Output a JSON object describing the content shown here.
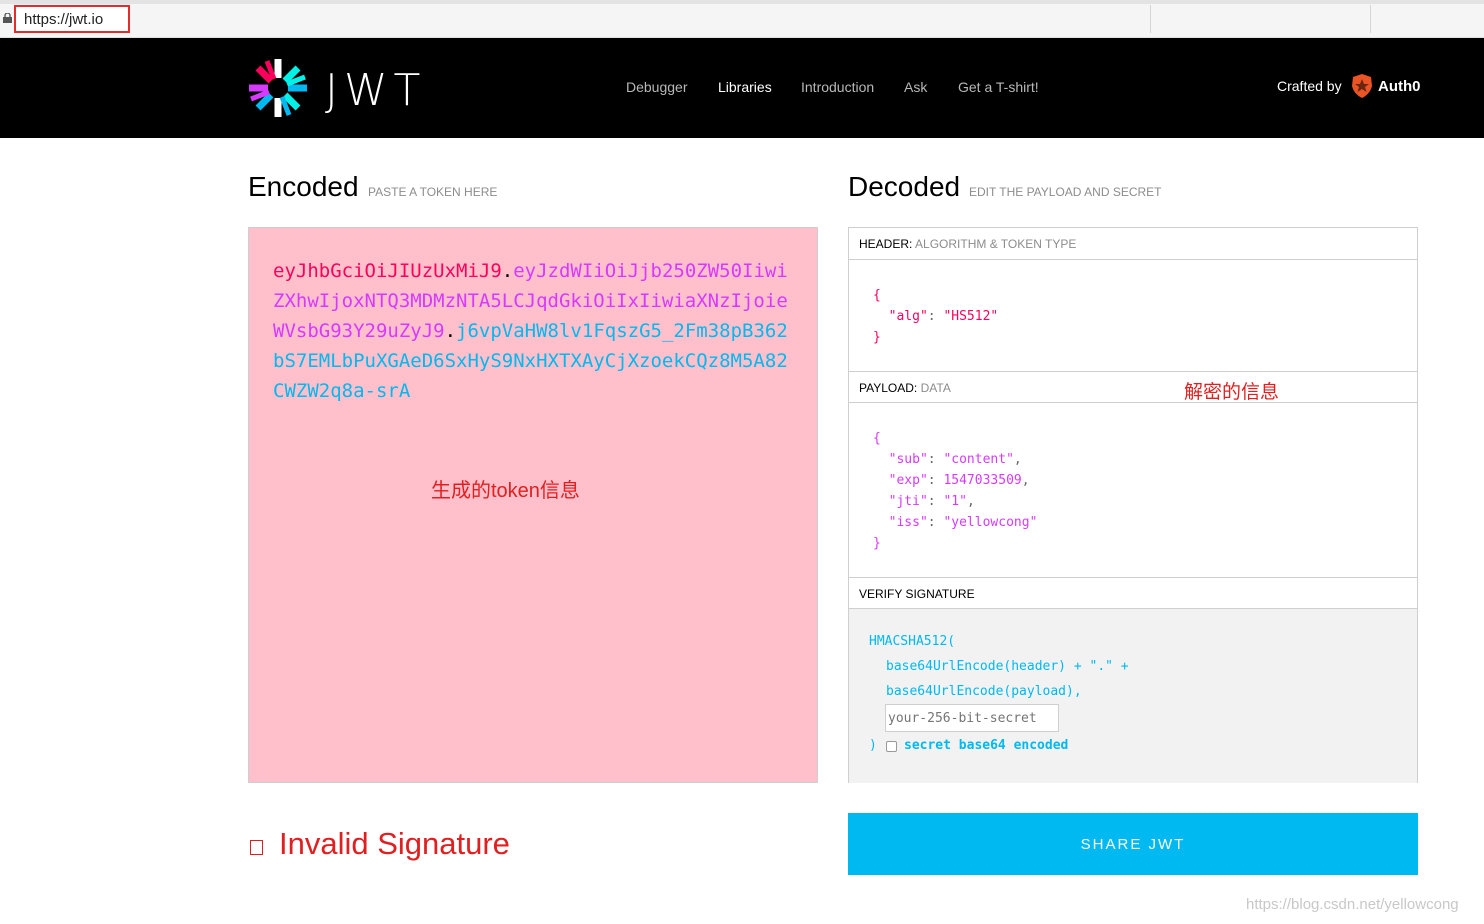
{
  "browser": {
    "url": "https://jwt.io"
  },
  "nav": {
    "logo_text": "JWT",
    "links": [
      "Debugger",
      "Libraries",
      "Introduction",
      "Ask",
      "Get a T-shirt!"
    ],
    "active": "Libraries",
    "crafted_by": "Crafted by",
    "brand": "Auth0"
  },
  "encoded": {
    "title": "Encoded",
    "subtitle": "PASTE A TOKEN HERE",
    "token_header": "eyJhbGciOiJIUzUxMiJ9",
    "token_payload": "eyJzdWIiOiJjb250ZW50IiwiZXhwIjoxNTQ3MDMzNTA5LCJqdGkiOiIxIiwiaXNzIjoieWVsbG93Y29uZyJ9",
    "token_signature": "j6vpVaHW8lv1FqszG5_2Fm38pB362bS7EMLbPuXGAeD6SxHyS9NxHXTXAyCjXzoekCQz8M5A82CWZW2q8a-srA",
    "dot": ".",
    "annotation": "生成的token信息"
  },
  "decoded": {
    "title": "Decoded",
    "subtitle": "EDIT THE PAYLOAD AND SECRET",
    "header_section": {
      "label": "HEADER:",
      "sublabel": "ALGORITHM & TOKEN TYPE"
    },
    "header_json": {
      "alg": "HS512"
    },
    "payload_section": {
      "label": "PAYLOAD:",
      "sublabel": "DATA"
    },
    "payload_annotation": "解密的信息",
    "payload_json": {
      "sub": "content",
      "exp": "1547033509",
      "jti": "1",
      "iss": "yellowcong"
    },
    "verify_section": {
      "label": "VERIFY SIGNATURE"
    },
    "verify": {
      "fn_open": "HMACSHA512(",
      "line1": "base64UrlEncode(header) + \".\" +",
      "line2": "base64UrlEncode(payload),",
      "secret_placeholder": "your-256-bit-secret",
      "fn_close": ")",
      "checkbox_label": "secret base64 encoded"
    }
  },
  "status": {
    "signature_text": "Invalid Signature",
    "share_label": "SHARE JWT"
  },
  "watermark": "https://blog.csdn.net/yellowcong",
  "colors": {
    "header": "#fb015b",
    "payload": "#d63aff",
    "signature": "#00b9f1",
    "error": "#e02020",
    "encoded_bg": "#ffc0cb"
  }
}
